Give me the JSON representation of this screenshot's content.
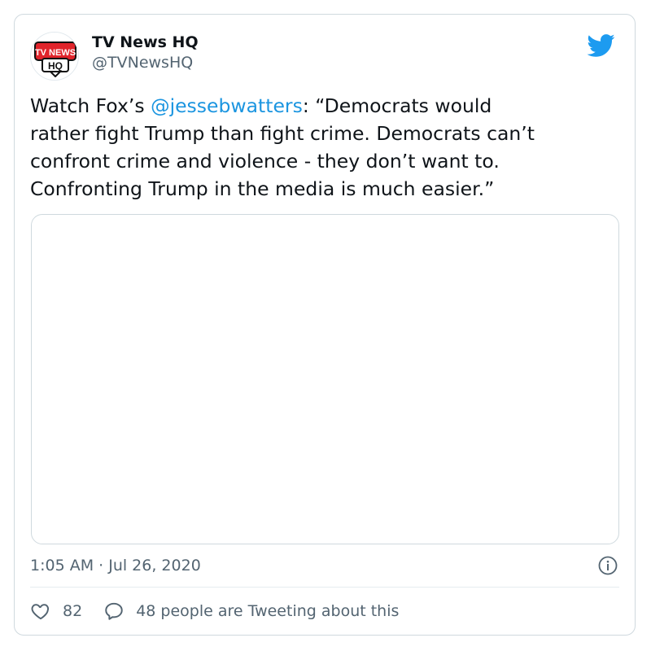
{
  "author": {
    "display_name": "TV News HQ",
    "handle": "@TVNewsHQ",
    "avatar_text_line1": "TV NEWS",
    "avatar_text_line2": "HQ"
  },
  "tweet": {
    "text_prefix": "Watch Fox’s ",
    "mention": "@jessebwatters",
    "text_suffix": ": “Democrats would\nrather fight Trump than fight crime. Democrats  can’t\nconfront crime and violence - they don’t want to.\nConfronting Trump in the media is much easier.”",
    "timestamp": "1:05 AM · Jul 26, 2020"
  },
  "actions": {
    "like_count": "82",
    "conversation_label": "48 people are Tweeting about this"
  },
  "icons": {
    "brand": "twitter-bird-icon",
    "info": "info-icon",
    "like": "heart-icon",
    "reply": "speech-bubble-icon"
  },
  "colors": {
    "brand_blue": "#1d9bf0",
    "mention_blue": "#1b95e0",
    "muted_text": "#536471",
    "border": "#cfd9de",
    "avatar_red": "#e0242b"
  }
}
